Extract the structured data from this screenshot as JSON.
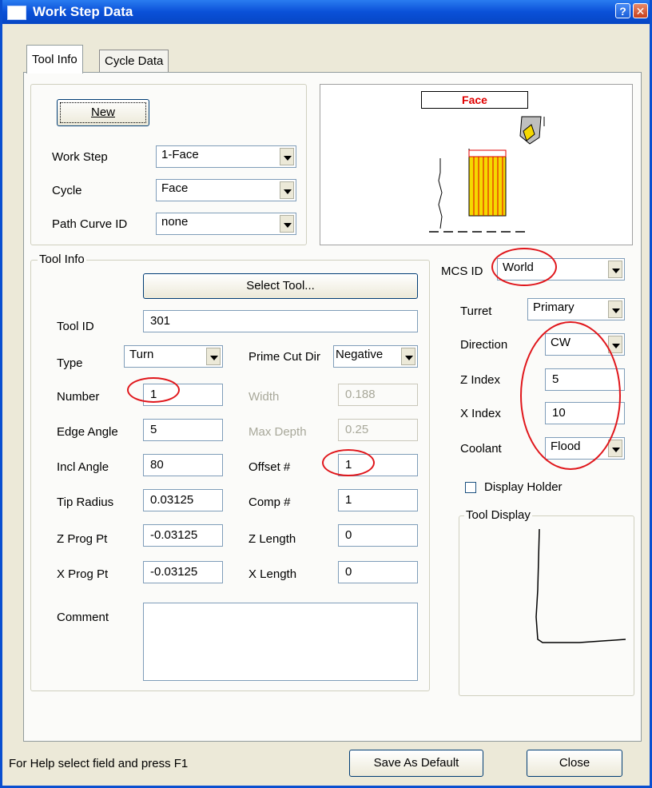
{
  "window": {
    "title": "Work Step Data",
    "help_glyph": "?",
    "close_glyph": "✕"
  },
  "tabs": {
    "tool_info": "Tool Info",
    "cycle_data": "Cycle Data"
  },
  "work_step_group": {
    "new_button": "New",
    "work_step_label": "Work Step",
    "work_step_value": "1-Face",
    "cycle_label": "Cycle",
    "cycle_value": "Face",
    "path_curve_label": "Path Curve ID",
    "path_curve_value": "none"
  },
  "preview": {
    "label": "Face"
  },
  "tool_info": {
    "group_title": "Tool Info",
    "select_tool_button": "Select Tool...",
    "tool_id_label": "Tool  ID",
    "tool_id_value": "301",
    "type_label": "Type",
    "type_value": "Turn",
    "prime_cut_dir_label": "Prime Cut Dir",
    "prime_cut_dir_value": "Negative",
    "number_label": "Number",
    "number_value": "1",
    "width_label": "Width",
    "width_value": "0.188",
    "edge_angle_label": "Edge Angle",
    "edge_angle_value": "5",
    "max_depth_label": "Max Depth",
    "max_depth_value": "0.25",
    "incl_angle_label": "Incl Angle",
    "incl_angle_value": "80",
    "offset_label": "Offset #",
    "offset_value": "1",
    "tip_radius_label": "Tip Radius",
    "tip_radius_value": "0.03125",
    "comp_label": "Comp #",
    "comp_value": "1",
    "z_prog_pt_label": "Z Prog Pt",
    "z_prog_pt_value": "-0.03125",
    "z_length_label": "Z Length",
    "z_length_value": "0",
    "x_prog_pt_label": "X Prog Pt",
    "x_prog_pt_value": "-0.03125",
    "x_length_label": "X Length",
    "x_length_value": "0",
    "comment_label": "Comment",
    "comment_value": ""
  },
  "right_panel": {
    "mcs_id_label": "MCS ID",
    "mcs_id_value": "World",
    "turret_label": "Turret",
    "turret_value": "Primary",
    "direction_label": "Direction",
    "direction_value": "CW",
    "z_index_label": "Z Index",
    "z_index_value": "5",
    "x_index_label": "X Index",
    "x_index_value": "10",
    "coolant_label": "Coolant",
    "coolant_value": "Flood",
    "display_holder_label": "Display Holder",
    "display_holder_checked": false,
    "tool_display_title": "Tool Display"
  },
  "status": {
    "help_text": "For Help select field and press F1",
    "save_default_button": "Save As Default",
    "close_button": "Close"
  },
  "colors": {
    "annotation_red": "#e0161b",
    "titlebar_blue": "#0a50d8",
    "tool_yellow": "#f5d800"
  }
}
